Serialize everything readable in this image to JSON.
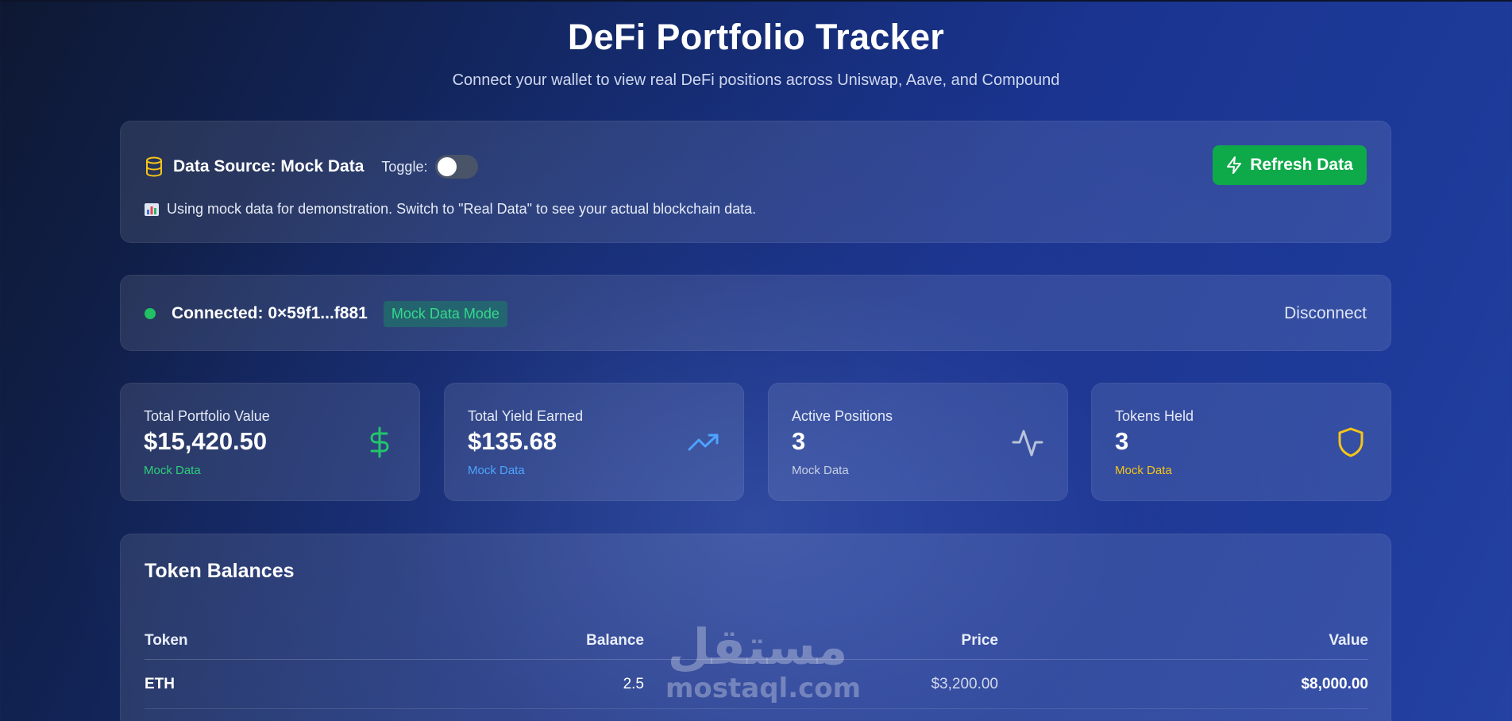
{
  "header": {
    "title": "DeFi Portfolio Tracker",
    "subtitle": "Connect your wallet to view real DeFi positions across Uniswap, Aave, and Compound"
  },
  "data_source": {
    "label": "Data Source: Mock Data",
    "toggle_label": "Toggle:",
    "toggle_on": false,
    "note": "Using mock data for demonstration. Switch to \"Real Data\" to see your actual blockchain data.",
    "refresh_label": "Refresh Data",
    "icon": "database-icon",
    "note_icon": "bar-chart-icon"
  },
  "connection": {
    "status_text": "Connected: 0×59f1...f881",
    "badge": "Mock Data Mode",
    "disconnect_label": "Disconnect",
    "status_color": "#21c063"
  },
  "stats": [
    {
      "label": "Total Portfolio Value",
      "value": "$15,420.50",
      "sub": "Mock Data",
      "sub_color": "#2ad07a",
      "icon": "dollar-icon"
    },
    {
      "label": "Total Yield Earned",
      "value": "$135.68",
      "sub": "Mock Data",
      "sub_color": "#4ea3ff",
      "icon": "trending-up-icon"
    },
    {
      "label": "Active Positions",
      "value": "3",
      "sub": "Mock Data",
      "sub_color": "#c8d0e4",
      "icon": "activity-icon"
    },
    {
      "label": "Tokens Held",
      "value": "3",
      "sub": "Mock Data",
      "sub_color": "#f5c518",
      "icon": "shield-icon"
    }
  ],
  "token_balances": {
    "title": "Token Balances",
    "columns": [
      "Token",
      "Balance",
      "Price",
      "Value"
    ],
    "rows": [
      {
        "token": "ETH",
        "balance": "2.5",
        "price": "$3,200.00",
        "value": "$8,000.00"
      }
    ]
  },
  "watermark": {
    "arabic": "مستقل",
    "latin": "mostaql.com"
  },
  "colors": {
    "accent_green": "#0eaa4a",
    "badge_text": "#34d98a"
  }
}
